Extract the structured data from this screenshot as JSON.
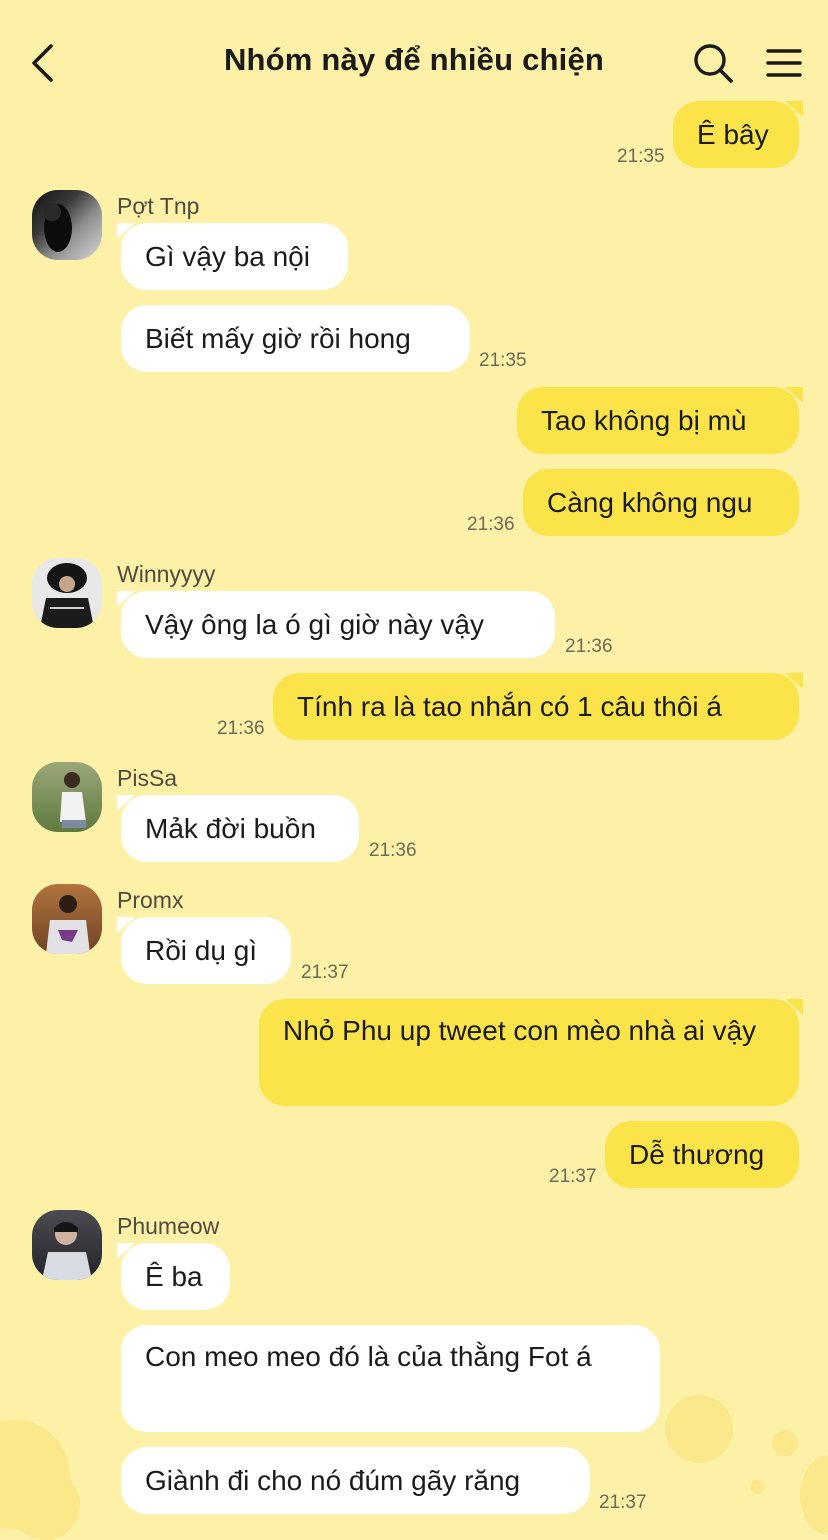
{
  "header": {
    "title": "Nhóm này để nhiều chiện",
    "back_icon": "chevron-left-icon",
    "search_icon": "search-icon",
    "menu_icon": "menu-icon"
  },
  "colors": {
    "background": "#fdf1a8",
    "outgoing_bubble": "#fbe34a",
    "incoming_bubble": "#ffffff"
  },
  "messages": [
    {
      "dir": "out",
      "text": "Ê bây",
      "time": "21:35"
    },
    {
      "dir": "in",
      "sender": "Pợt Tnp",
      "text": "Gì vậy ba nội"
    },
    {
      "dir": "in",
      "text": "Biết mấy giờ rồi hong",
      "time": "21:35"
    },
    {
      "dir": "out",
      "text": "Tao không bị mù"
    },
    {
      "dir": "out",
      "text": "Càng không ngu",
      "time": "21:36"
    },
    {
      "dir": "in",
      "sender": "Winnyyyy",
      "text": "Vậy ông la ó gì giờ này vậy",
      "time": "21:36"
    },
    {
      "dir": "out",
      "text": "Tính ra là tao nhắn có 1 câu thôi á",
      "time": "21:36"
    },
    {
      "dir": "in",
      "sender": "PisSa",
      "text": "Mảk đời buồn",
      "time": "21:36"
    },
    {
      "dir": "in",
      "sender": "Promx",
      "text": "Rồi dụ gì",
      "time": "21:37"
    },
    {
      "dir": "out",
      "text": "Nhỏ Phu up tweet con mèo nhà ai vậy"
    },
    {
      "dir": "out",
      "text": "Dễ thương",
      "time": "21:37"
    },
    {
      "dir": "in",
      "sender": "Phumeow",
      "text": "Ê ba"
    },
    {
      "dir": "in",
      "text": "Con meo meo đó là của thằng Fot á"
    },
    {
      "dir": "in",
      "text": "Giành đi cho nó đúm gãy răng",
      "time": "21:37"
    }
  ]
}
